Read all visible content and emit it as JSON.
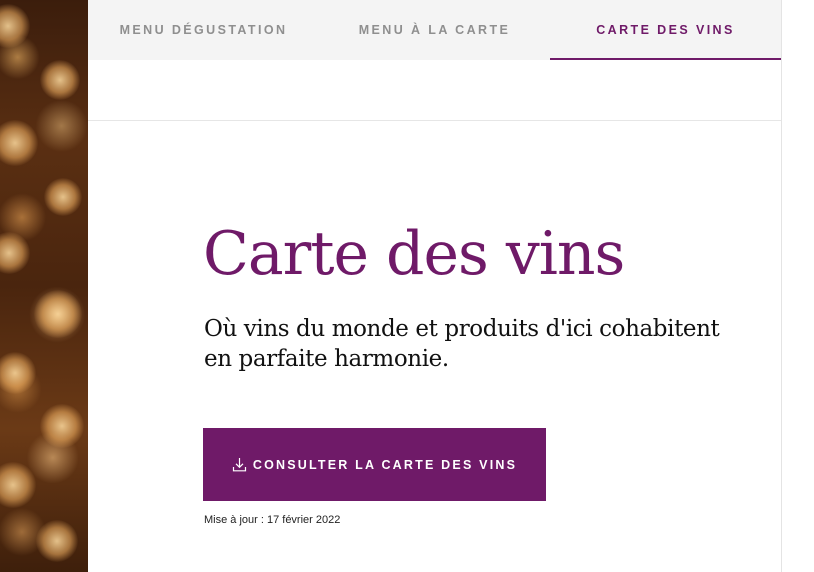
{
  "tabs": [
    {
      "label": "MENU DÉGUSTATION",
      "active": false
    },
    {
      "label": "MENU À LA CARTE",
      "active": false
    },
    {
      "label": "CARTE DES VINS",
      "active": true
    }
  ],
  "main": {
    "title": "Carte des vins",
    "subtitle": "Où vins du monde et produits d'ici cohabitent en parfaite harmonie.",
    "cta_label": "CONSULTER LA CARTE DES VINS",
    "cta_icon": "download-icon",
    "updated": "Mise à jour : 17 février 2022"
  },
  "colors": {
    "accent": "#6f1a68",
    "tab_background": "#f4f4f4",
    "tab_inactive_text": "#8f8f8f"
  }
}
